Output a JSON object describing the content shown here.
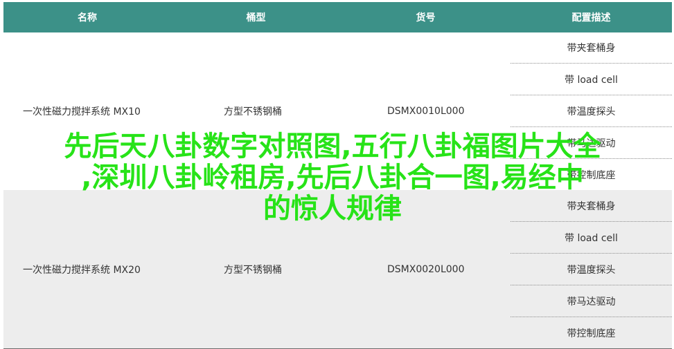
{
  "table": {
    "headers": [
      "名称",
      "桶型",
      "货号",
      "配置描述"
    ],
    "groups": [
      {
        "name": "一次性磁力搅拌系统 MX10",
        "type": "方型不锈钢桶",
        "code": "DSMX0010L000",
        "configs": [
          "带夹套桶身",
          "带 load cell",
          "带温度探头",
          "带马达驱动",
          "带控制底座"
        ]
      },
      {
        "name": "一次性磁力搅拌系统 MX20",
        "type": "方型不锈钢桶",
        "code": "DSMX0020L000",
        "configs": [
          "带夹套桶身",
          "带 load cell",
          "带温度探头",
          "带马达驱动",
          "带控制底座"
        ]
      }
    ]
  },
  "overlay": {
    "line1": "先后天八卦数字对照图,五行八卦福图片大全",
    "line2": ",深圳八卦岭租房,先后八卦合一图,易经中",
    "line3": "的惊人规律"
  },
  "colors": {
    "header_bg": "#3c9188",
    "overlay_text": "#27e318",
    "row_alt": "#ededed"
  }
}
